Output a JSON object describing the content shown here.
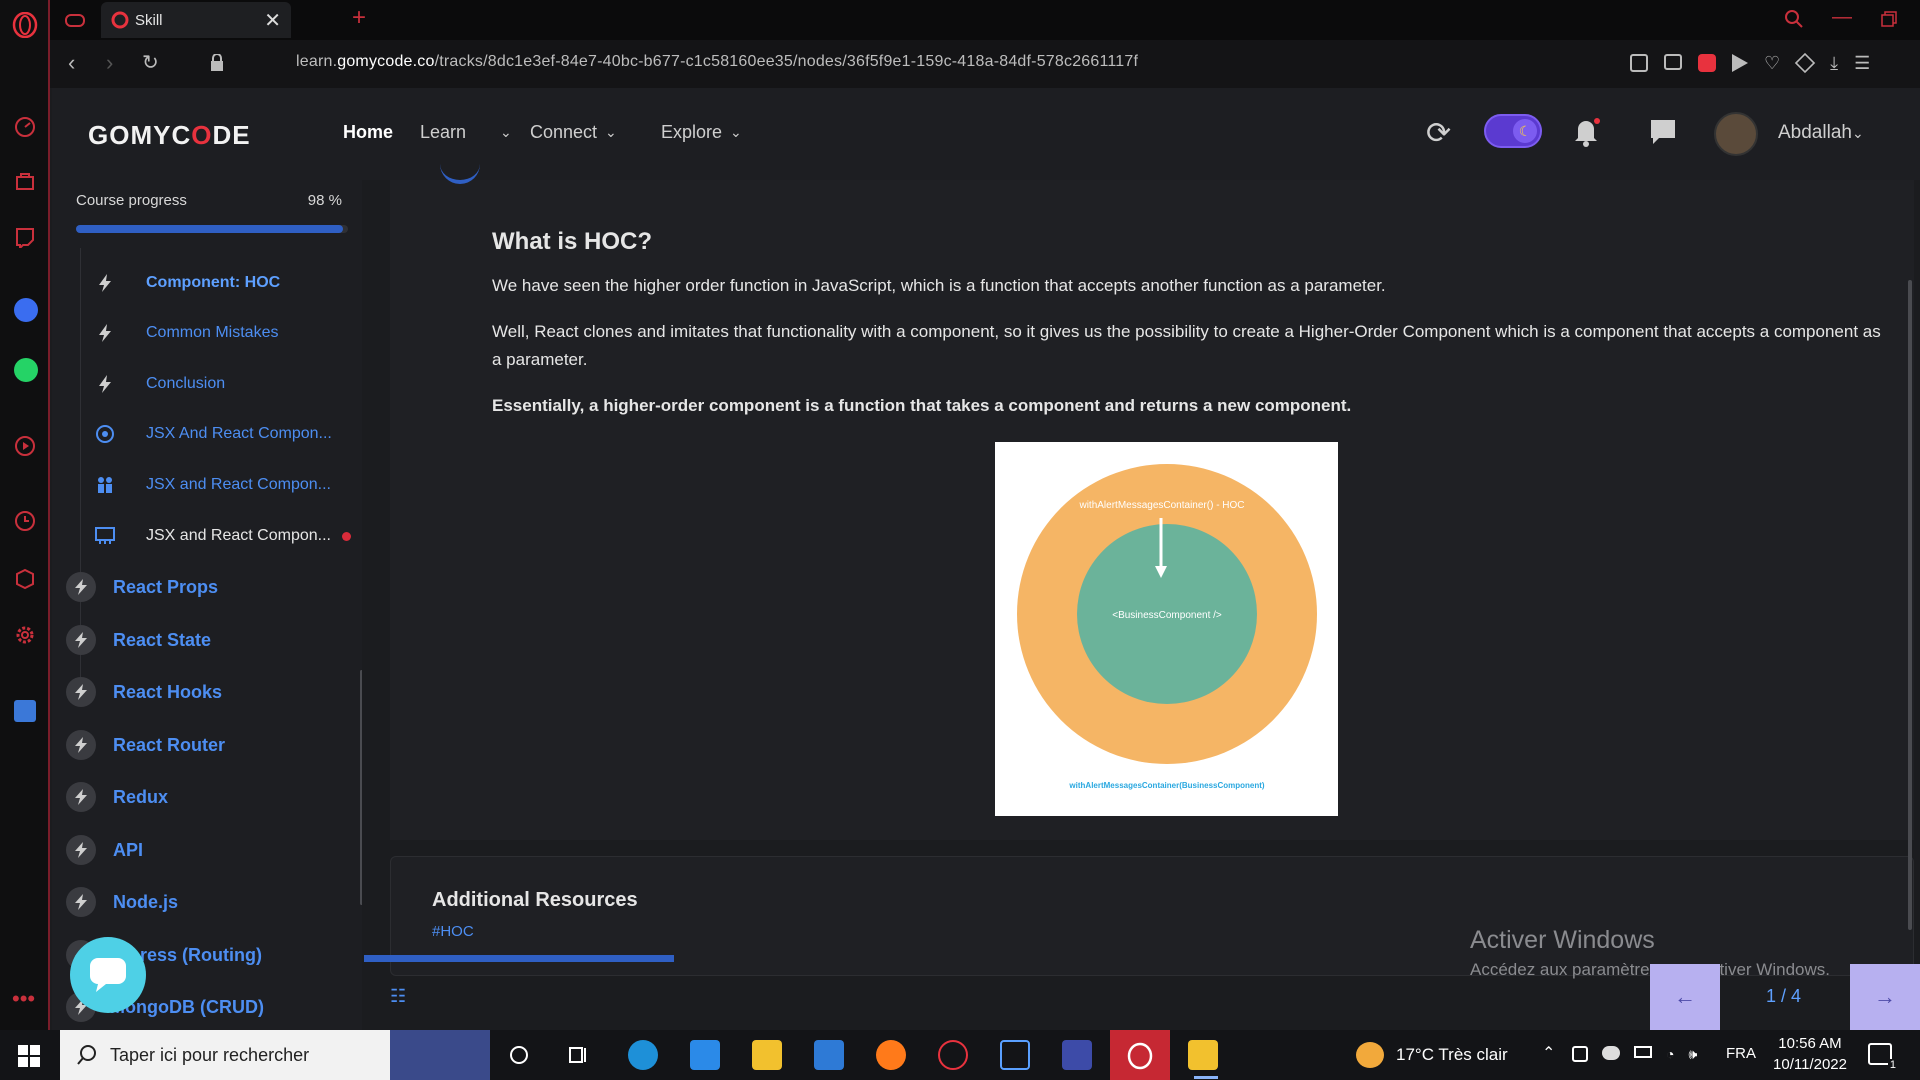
{
  "browser": {
    "tab_title": "Skill",
    "url_prefix": "learn.",
    "url_domain": "gomycode.co",
    "url_path": "/tracks/8dc1e3ef-84e7-40bc-b677-c1c58160ee35/nodes/36f5f9e1-159c-418a-84df-578c2661117f"
  },
  "header": {
    "logo_part1": "GOMYC",
    "logo_part2": "DE",
    "nav": [
      {
        "label": "Home"
      },
      {
        "label": "Learn"
      },
      {
        "label": "Connect"
      },
      {
        "label": "Explore"
      }
    ],
    "username": "Abdallah"
  },
  "sidebar": {
    "progress_label": "Course progress",
    "progress_value": "98 %",
    "progress_fraction": 0.98,
    "sub_items": [
      {
        "label": "Component: HOC",
        "icon": "bolt-icon"
      },
      {
        "label": "Common Mistakes",
        "icon": "bolt-icon"
      },
      {
        "label": "Conclusion",
        "icon": "bolt-icon"
      },
      {
        "label": "JSX And React Compon...",
        "icon": "target-icon"
      },
      {
        "label": "JSX and React Compon...",
        "icon": "people-icon"
      },
      {
        "label": "JSX and React Compon...",
        "icon": "presentation-icon"
      }
    ],
    "modules": [
      {
        "label": "React Props"
      },
      {
        "label": "React State"
      },
      {
        "label": "React Hooks"
      },
      {
        "label": "React Router"
      },
      {
        "label": "Redux"
      },
      {
        "label": "API"
      },
      {
        "label": "Node.js"
      },
      {
        "label": "ress (Routing)"
      },
      {
        "label": "MongoDB (CRUD)"
      }
    ]
  },
  "content": {
    "title": "What is HOC?",
    "p1": "We have seen the higher order function in JavaScript, which is a function that accepts another function as a parameter.",
    "p2": "Well, React clones and imitates that functionality with a component, so it gives us the possibility to create a Higher-Order Component which is a component that accepts a component as a parameter.",
    "p3": "Essentially, a higher-order component is a function that takes a component and returns a new component.",
    "figure": {
      "outer_label": "withAlertMessagesContainer() - HOC",
      "inner_label": "<BusinessComponent />",
      "caption": "withAlertMessagesContainer(BusinessComponent)"
    },
    "resources_title": "Additional Resources",
    "resources_tag": "#HOC",
    "pager": "1 / 4"
  },
  "watermark": {
    "line1": "Activer Windows",
    "line2": "Accédez aux paramètres pour activer Windows."
  },
  "taskbar": {
    "search_placeholder": "Taper ici pour rechercher",
    "weather": "17°C  Très clair",
    "lang": "FRA",
    "time": "10:56 AM",
    "date": "10/11/2022",
    "notification_count": "1"
  },
  "colors": {
    "accent_blue": "#4d8ef2",
    "brand_red": "#e8323e",
    "hoc_orange": "#f5b565",
    "component_green": "#6bb39a"
  }
}
